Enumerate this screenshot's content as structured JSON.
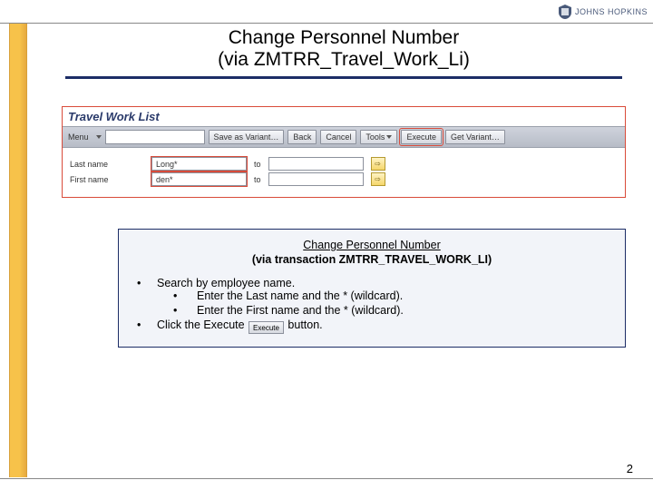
{
  "header": {
    "brand": "JOHNS HOPKINS"
  },
  "title": {
    "line1": "Change Personnel Number",
    "line2": "(via ZMTRR_Travel_Work_Li)"
  },
  "sap": {
    "window_title": "Travel Work List",
    "menu_label": "Menu",
    "save_variant": "Save as Variant…",
    "back": "Back",
    "cancel": "Cancel",
    "tools": "Tools",
    "execute": "Execute",
    "get_variant": "Get Variant…",
    "form": {
      "last_label": "Last name",
      "first_label": "First name",
      "last_value": "Long*",
      "first_value": "den*",
      "to": "to"
    }
  },
  "instructions": {
    "heading_line1": "Change Personnel Number",
    "heading_line2": "(via transaction ZMTRR_TRAVEL_WORK_LI)",
    "item1": "Search by employee name.",
    "item1a": "Enter the Last name and the * (wildcard).",
    "item1b": "Enter the First name and the * (wildcard).",
    "item2_pre": "Click the Execute ",
    "item2_btn": "Execute",
    "item2_post": " button."
  },
  "page_number": "2"
}
